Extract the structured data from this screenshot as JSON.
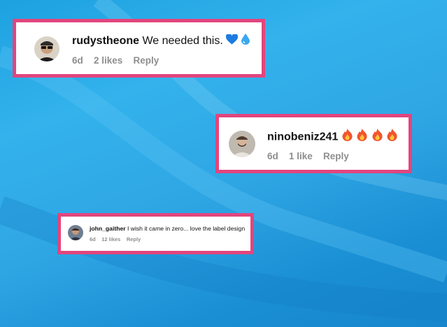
{
  "comments": [
    {
      "username": "rudystheone",
      "text": "We needed this.",
      "emojis": [
        "blue-heart-icon",
        "droplet-icon"
      ],
      "age": "6d",
      "likes": "2 likes",
      "reply_label": "Reply"
    },
    {
      "username": "ninobeniz241",
      "text": "",
      "emojis": [
        "fire-icon",
        "fire-icon",
        "fire-icon",
        "fire-icon"
      ],
      "age": "6d",
      "likes": "1 like",
      "reply_label": "Reply"
    },
    {
      "username": "john_gaither",
      "text": "I wish it came in zero... love the label design",
      "emojis": [],
      "age": "6d",
      "likes": "12 likes",
      "reply_label": "Reply"
    }
  ],
  "colors": {
    "highlight_border": "#e2457e",
    "background": "#2fa6e4",
    "meta_text": "#8e8e8e",
    "blue_heart": "#1e7be0",
    "droplet": "#3aa9f0",
    "fire": "#f2542d"
  }
}
